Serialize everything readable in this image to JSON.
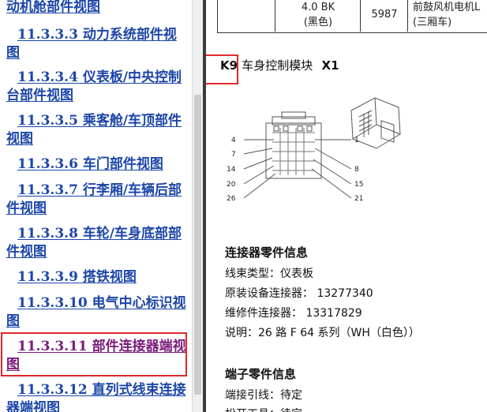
{
  "nav": {
    "items": [
      {
        "label": "动机舱部件视图"
      },
      {
        "label": "11.3.3.3 动力系统部件视图"
      },
      {
        "label": "11.3.3.4 仪表板/中央控制台部件视图"
      },
      {
        "label": "11.3.3.5 乘客舱/车顶部件视图"
      },
      {
        "label": "11.3.3.6 车门部件视图"
      },
      {
        "label": "11.3.3.7 行李厢/车辆后部件视图"
      },
      {
        "label": "11.3.3.8 车轮/车身底部部件视图"
      },
      {
        "label": "11.3.3.9 搭铁视图"
      },
      {
        "label": "11.3.3.10 电气中心标识视图"
      },
      {
        "label": "11.3.3.11 部件连接器端视图"
      },
      {
        "label": "11.3.3.12 直列式线束连接器端视图"
      }
    ]
  },
  "doc": {
    "table_row": {
      "color_line1": "4.0 BK",
      "color_line2": "(黑色)",
      "circuit": "5987",
      "desc_line1": "前鼓风机电机L",
      "desc_line2": "(三厢车)"
    },
    "component_id": "K9",
    "component_title": "车身控制模块",
    "connector_id": "X1",
    "diagram_pins": [
      "4",
      "7",
      "14",
      "20",
      "26",
      "1",
      "8",
      "15",
      "21"
    ],
    "connector_section_title": "连接器零件信息",
    "harness_type": "线束类型：仪表板",
    "oem_connector": "原装设备连接器：   13277340",
    "service_connector": "维修件连接器：   13317829",
    "description": "说明：26 路  F 64 系列（WH（白色））",
    "terminal_section_title": "端子零件信息",
    "terminal_lead": "端接引线：待定",
    "release_tool": "松开工具：待定"
  },
  "colors": {
    "link": "#1c46a8",
    "visited_link": "#7a1b7a",
    "highlight": "#e0282a"
  }
}
